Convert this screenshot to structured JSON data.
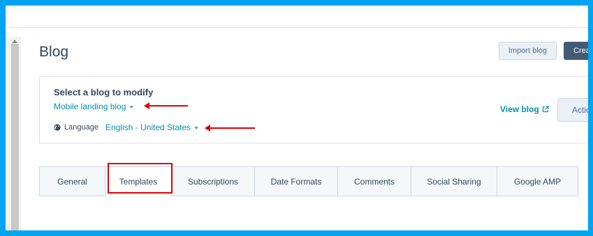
{
  "header": {
    "title": "Blog",
    "import_label": "Import blog",
    "create_label": "Create blog"
  },
  "selector": {
    "heading": "Select a blog to modify",
    "blog_value": "Mobile landing blog",
    "language_label": "Language",
    "language_value": "English - United States",
    "view_blog_label": "View blog",
    "actions_label": "Actions"
  },
  "tabs": [
    {
      "label": "General"
    },
    {
      "label": "Templates",
      "active": true
    },
    {
      "label": "Subscriptions"
    },
    {
      "label": "Date Formats"
    },
    {
      "label": "Comments"
    },
    {
      "label": "Social Sharing"
    },
    {
      "label": "Google AMP"
    }
  ],
  "annotations": {
    "color": "#e00000",
    "highlighted_tab": "Templates"
  },
  "colors": {
    "border": "#00a4f0",
    "link": "#0091ae",
    "text": "#33475b",
    "primary_button": "#425b76"
  },
  "icons": {
    "globe": "globe-icon",
    "external_link": "external-link-icon",
    "caret": "caret-down-icon"
  }
}
